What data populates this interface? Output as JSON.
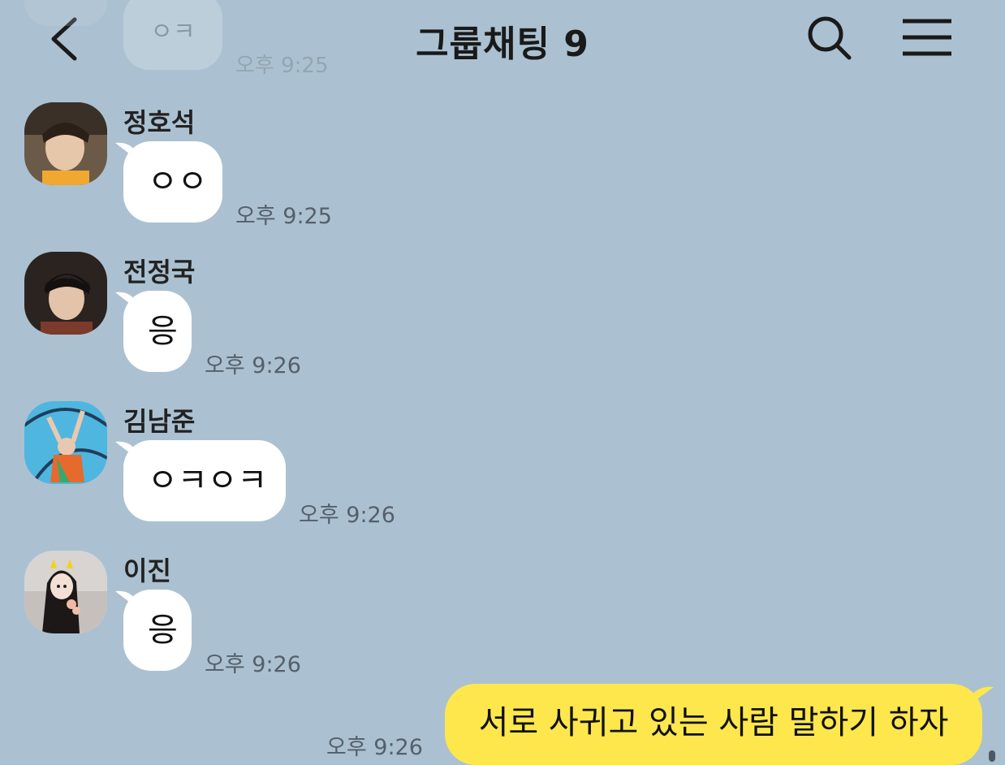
{
  "header": {
    "title": "그룹채팅 9",
    "back_icon": "chevron-left-icon",
    "search_icon": "search-icon",
    "menu_icon": "hamburger-menu-icon"
  },
  "previous_message": {
    "text": "ㅇㅋ",
    "time": "오후 9:25"
  },
  "messages": [
    {
      "sender": "정호석",
      "text": "ㅇㅇ",
      "time": "오후 9:25"
    },
    {
      "sender": "전정국",
      "text": "응",
      "time": "오후 9:26"
    },
    {
      "sender": "김남준",
      "text": "ㅇㅋㅇㅋ",
      "time": "오후 9:26"
    },
    {
      "sender": "이진",
      "text": "응",
      "time": "오후 9:26"
    }
  ],
  "my_message": {
    "text": "서로 사귀고 있는 사람 말하기 하자",
    "time": "오후 9:26"
  },
  "colors": {
    "background": "#abc1d1",
    "incoming_bubble": "#ffffff",
    "outgoing_bubble": "#fde74c"
  }
}
